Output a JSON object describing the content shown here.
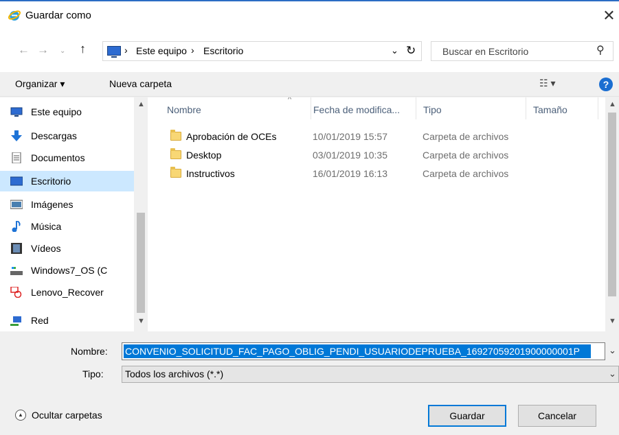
{
  "window": {
    "title": "Guardar como",
    "close_glyph": "✕"
  },
  "nav": {
    "back_glyph": "←",
    "forward_glyph": "→",
    "recent_glyph": "⌄",
    "up_glyph": "↑",
    "refresh_glyph": "↻"
  },
  "address": {
    "segments": [
      "Este equipo",
      "Escritorio"
    ],
    "separator": "›",
    "dropdown_glyph": "⌄"
  },
  "search": {
    "placeholder": "Buscar en Escritorio",
    "icon_glyph": "⚲"
  },
  "toolbar": {
    "organize_label": "Organizar ▾",
    "new_folder_label": "Nueva carpeta",
    "view_glyph": "☷ ▾",
    "help_glyph": "?"
  },
  "sidebar": {
    "items": [
      {
        "label": "Este equipo",
        "icon": "computer-icon"
      },
      {
        "label": "Descargas",
        "icon": "download-icon"
      },
      {
        "label": "Documentos",
        "icon": "documents-icon"
      },
      {
        "label": "Escritorio",
        "icon": "desktop-icon",
        "selected": true
      },
      {
        "label": "Imágenes",
        "icon": "pictures-icon"
      },
      {
        "label": "Música",
        "icon": "music-icon"
      },
      {
        "label": "Vídeos",
        "icon": "videos-icon"
      },
      {
        "label": "Windows7_OS (C",
        "icon": "drive-icon"
      },
      {
        "label": "Lenovo_Recover",
        "icon": "recovery-drive-icon"
      },
      {
        "label": "Red",
        "icon": "network-icon"
      }
    ]
  },
  "filelist": {
    "columns": [
      "Nombre",
      "Fecha de modifica...",
      "Tipo",
      "Tamaño"
    ],
    "sort_glyph": "^",
    "rows": [
      {
        "name": "Aprobación de OCEs",
        "date": "10/01/2019 15:57",
        "type": "Carpeta de archivos"
      },
      {
        "name": "Desktop",
        "date": "03/01/2019 10:35",
        "type": "Carpeta de archivos"
      },
      {
        "name": "Instructivos",
        "date": "16/01/2019 16:13",
        "type": "Carpeta de archivos"
      }
    ]
  },
  "scroll": {
    "up_glyph": "▲",
    "down_glyph": "▼"
  },
  "bottom": {
    "filename_label": "Nombre:",
    "filename_value": "CONVENIO_SOLICITUD_FAC_PAGO_OBLIG_PENDI_USUARIODEPRUEBA_16927059201900000001P",
    "type_label": "Tipo:",
    "type_value": "Todos los archivos (*.*)",
    "dropdown_glyph": "⌄",
    "hide_folders_label": "Ocultar carpetas",
    "toggle_glyph": "▲",
    "save_label": "Guardar",
    "cancel_label": "Cancelar"
  },
  "colors": {
    "accent": "#0078d7",
    "selection": "#cce8ff",
    "title_border": "#2b6cc4"
  }
}
